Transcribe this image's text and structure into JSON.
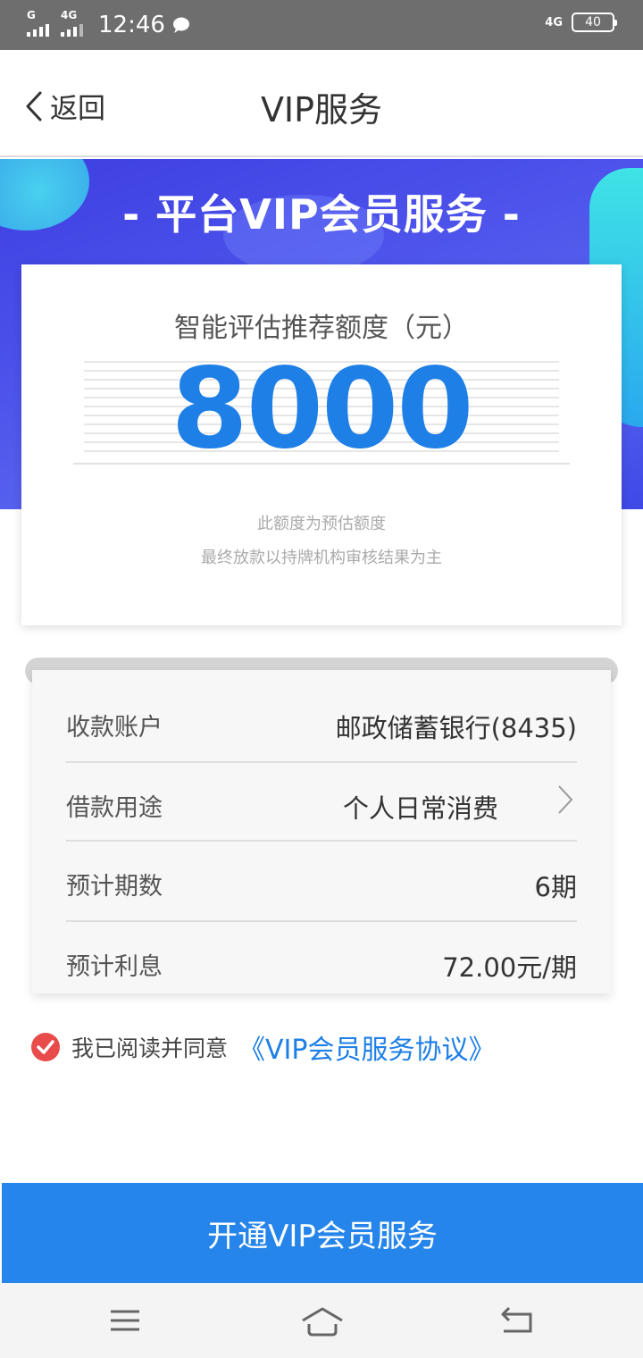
{
  "status_bar": {
    "signal1_label": "G",
    "signal2_label": "4G",
    "time": "12:46",
    "network": "4G",
    "battery": "40",
    "icons": [
      "signal-icon",
      "signal-icon",
      "chat-bubble-icon",
      "network-4g-icon",
      "battery-icon"
    ]
  },
  "nav": {
    "back_label": "返回",
    "title": "VIP服务"
  },
  "banner": {
    "title": "- 平台VIP会员服务 -"
  },
  "quota": {
    "label": "智能评估推荐额度（元）",
    "value": "8000",
    "note_line1": "此额度为预估额度",
    "note_line2": "最终放款以持牌机构审核结果为主"
  },
  "info": {
    "rows": [
      {
        "label": "收款账户",
        "value": "邮政储蓄银行(8435)"
      },
      {
        "label": "借款用途",
        "value": "个人日常消费"
      },
      {
        "label": "预计期数",
        "value": "6期"
      },
      {
        "label": "预计利息",
        "value": "72.00元/期"
      }
    ]
  },
  "agreement": {
    "checked": true,
    "text": "我已阅读并同意",
    "link": "《VIP会员服务协议》"
  },
  "cta": {
    "label": "开通VIP会员服务"
  },
  "system_nav": {
    "icons": [
      "menu-icon",
      "home-icon",
      "back-icon"
    ]
  },
  "colors": {
    "accent": "#2685ea",
    "value_blue": "#1e7fe6",
    "check_red": "#e94b4b",
    "banner": "#4b50ea"
  }
}
